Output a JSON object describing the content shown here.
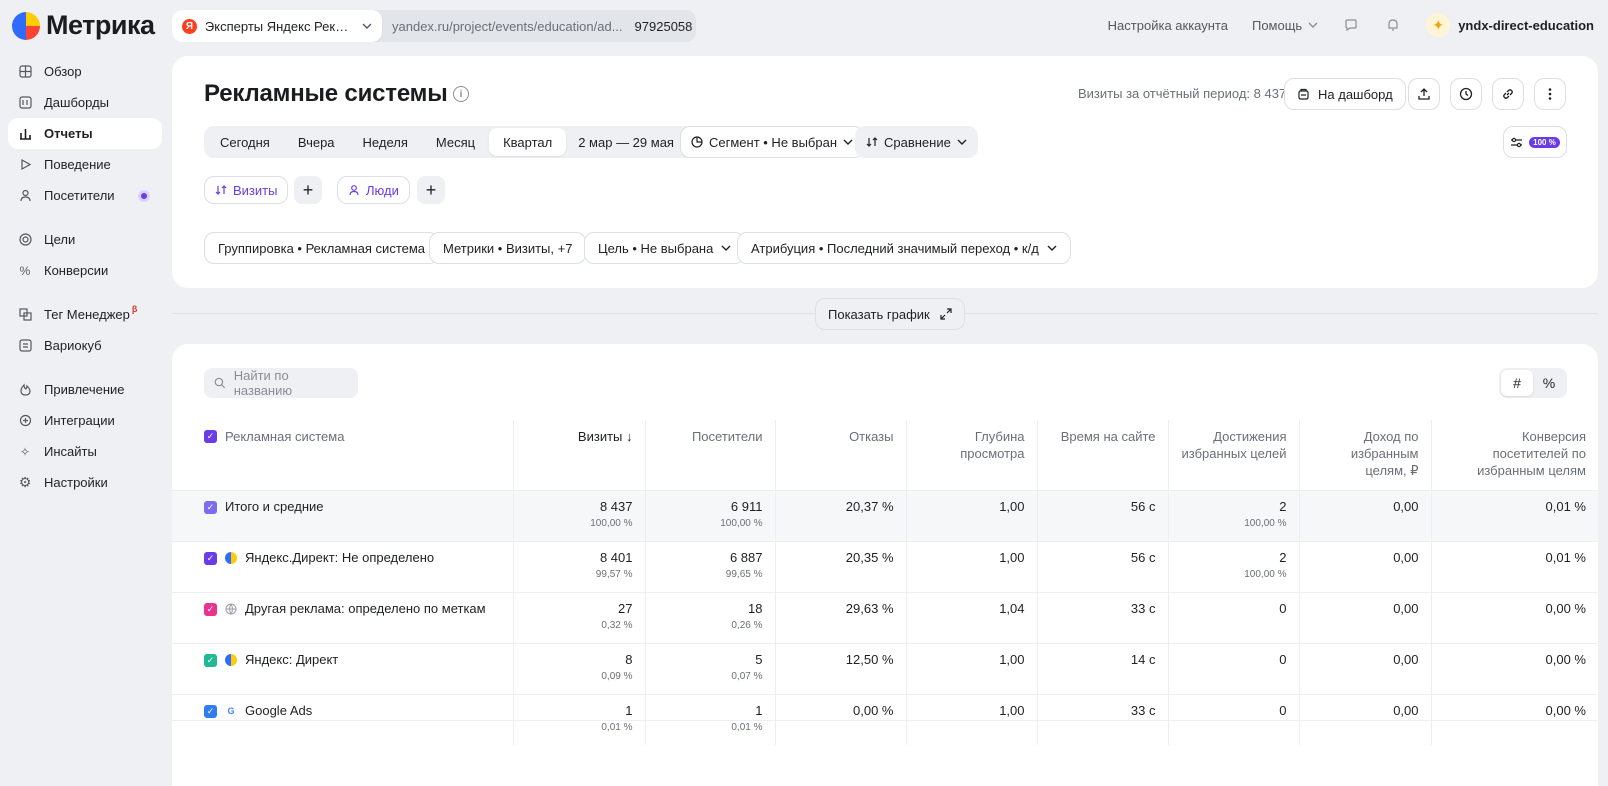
{
  "app": {
    "logo_text": "Метрика"
  },
  "project": {
    "name": "Эксперты Яндекс Рекла...",
    "url": "yandex.ru/project/events/education/ad...",
    "counter_id": "97925058"
  },
  "top_nav": {
    "account_settings": "Настройка аккаунта",
    "help": "Помощь",
    "username": "yndx-direct-education"
  },
  "sidebar": {
    "items": [
      {
        "label": "Обзор",
        "icon": "grid-icon"
      },
      {
        "label": "Дашборды",
        "icon": "dashboard-icon"
      },
      {
        "label": "Отчеты",
        "icon": "chart-bar-icon",
        "active": true
      },
      {
        "label": "Поведение",
        "icon": "play-icon"
      },
      {
        "label": "Посетители",
        "icon": "user-icon"
      },
      {
        "label": "Цели",
        "icon": "target-icon"
      },
      {
        "label": "Конверсии",
        "icon": "percent-icon"
      },
      {
        "label": "Тег Менеджер",
        "icon": "tag-manager-icon",
        "badge": "β"
      },
      {
        "label": "Вариокуб",
        "icon": "cube-icon"
      },
      {
        "label": "Привлечение",
        "icon": "flame-icon"
      },
      {
        "label": "Интеграции",
        "icon": "plug-icon"
      },
      {
        "label": "Инсайты",
        "icon": "sparkle-icon"
      },
      {
        "label": "Настройки",
        "icon": "gear-icon"
      }
    ]
  },
  "page": {
    "title": "Рекламные системы",
    "visits_total": "Визиты за отчётный период: 8 437",
    "dashboard_button": "На дашборд"
  },
  "period": {
    "options": [
      "Сегодня",
      "Вчера",
      "Неделя",
      "Месяц",
      "Квартал"
    ],
    "selected": "Квартал",
    "range": "2 мар — 29 мая"
  },
  "segment": {
    "label": "Сегмент • Не выбран"
  },
  "comparison": {
    "label": "Сравнение"
  },
  "zoom_badge": "100 %",
  "metric_chips": {
    "visits": "Визиты",
    "people": "Люди"
  },
  "filters": {
    "grouping": "Группировка • Рекламная система",
    "metrics": "Метрики • Визиты, +7",
    "goal": "Цель • Не выбрана",
    "attribution": "Атрибуция • Последний значимый переход • к/д"
  },
  "show_chart": "Показать график",
  "search": {
    "placeholder": "Найти по названию"
  },
  "toggle": {
    "hash": "#",
    "percent": "%"
  },
  "table": {
    "columns": [
      "Рекламная система",
      "Визиты ↓",
      "Посетители",
      "Отказы",
      "Глубина просмотра",
      "Время на сайте",
      "Достижения избранных целей",
      "Доход по избранным целям, ₽",
      "Конверсия посетителей по избранным целям"
    ],
    "rows": [
      {
        "name": "Итого и средние",
        "checkbox_color": "#7b6cf0",
        "icon": "none",
        "visits": "8 437",
        "visits_pct": "100,00 %",
        "visitors": "6 911",
        "visitors_pct": "100,00 %",
        "bounce": "20,37 %",
        "depth": "1,00",
        "time": "56 с",
        "goals": "2",
        "goals_pct": "100,00 %",
        "revenue": "0,00",
        "conversion": "0,01 %"
      },
      {
        "name": "Яндекс.Директ: Не определено",
        "checkbox_color": "#6a3ce8",
        "icon": "yandex-direct-icon",
        "visits": "8 401",
        "visits_pct": "99,57 %",
        "visitors": "6 887",
        "visitors_pct": "99,65 %",
        "bounce": "20,35 %",
        "depth": "1,00",
        "time": "56 с",
        "goals": "2",
        "goals_pct": "100,00 %",
        "revenue": "0,00",
        "conversion": "0,01 %"
      },
      {
        "name": "Другая реклама: определено по меткам",
        "checkbox_color": "#e8338f",
        "icon": "globe-icon",
        "visits": "27",
        "visits_pct": "0,32 %",
        "visitors": "18",
        "visitors_pct": "0,26 %",
        "bounce": "29,63 %",
        "depth": "1,04",
        "time": "33 с",
        "goals": "0",
        "goals_pct": "",
        "revenue": "0,00",
        "conversion": "0,00 %"
      },
      {
        "name": "Яндекс: Директ",
        "checkbox_color": "#21b894",
        "icon": "yandex-direct-icon",
        "visits": "8",
        "visits_pct": "0,09 %",
        "visitors": "5",
        "visitors_pct": "0,07 %",
        "bounce": "12,50 %",
        "depth": "1,00",
        "time": "14 с",
        "goals": "0",
        "goals_pct": "",
        "revenue": "0,00",
        "conversion": "0,00 %"
      },
      {
        "name": "Google Ads",
        "checkbox_color": "#2f7df0",
        "icon": "google-icon",
        "visits": "1",
        "visits_pct": "0,01 %",
        "visitors": "1",
        "visitors_pct": "0,01 %",
        "bounce": "0,00 %",
        "depth": "1,00",
        "time": "33 с",
        "goals": "0",
        "goals_pct": "",
        "revenue": "0,00",
        "conversion": "0,00 %"
      }
    ]
  }
}
